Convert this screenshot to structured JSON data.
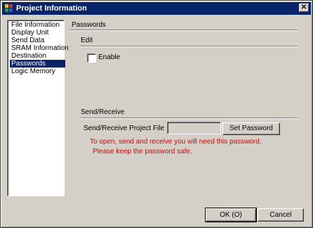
{
  "window": {
    "title": "Project Information",
    "close_glyph": "✕"
  },
  "nav": {
    "items": [
      {
        "label": "File Information",
        "selected": false
      },
      {
        "label": "Display Unit",
        "selected": false
      },
      {
        "label": "Send Data",
        "selected": false
      },
      {
        "label": "SRAM Information",
        "selected": false
      },
      {
        "label": "Destination",
        "selected": false
      },
      {
        "label": "Passwords",
        "selected": true
      },
      {
        "label": "Logic Memory",
        "selected": false
      }
    ]
  },
  "panel": {
    "title": "Passwords",
    "edit_section": "Edit",
    "enable_label": "Enable",
    "enable_checked": false,
    "send_receive_section": "Send/Receive",
    "send_receive_file_label": "Send/Receive Project File",
    "password_value": "",
    "set_password_button": "Set Password",
    "warning_line1": "To open, send and receive you will need this password.",
    "warning_line2": "Please keep the password safe."
  },
  "footer": {
    "ok_button": "OK (O)",
    "cancel_button": "Cancel"
  },
  "colors": {
    "titlebar": "#0a246a",
    "selection": "#0a246a",
    "warning_text": "#e00000",
    "face": "#d4d0c8"
  }
}
